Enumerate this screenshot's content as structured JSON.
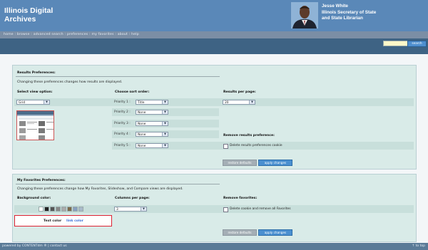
{
  "header": {
    "title_line1": "Illinois Digital",
    "title_line2": "Archives",
    "official_line1": "Jesse White",
    "official_line2": "Illinois Secretary of State",
    "official_line3": "and State Librarian",
    "bg_color": "#5a88b8"
  },
  "nav": {
    "items": [
      "home",
      "browse",
      "advanced search",
      "preferences",
      "my favorites",
      "about",
      "help"
    ],
    "separator": " : "
  },
  "search": {
    "placeholder": "",
    "button_label": "search"
  },
  "results_prefs": {
    "title": "Results Preferences:",
    "description": "Changing these preferences changes how results are displayed.",
    "view_label": "Select view option:",
    "view_value": "Grid",
    "sort_label": "Choose sort order:",
    "priorities": [
      {
        "label": "Priority 1 :",
        "value": "Title"
      },
      {
        "label": "Priority 2 :",
        "value": "None"
      },
      {
        "label": "Priority 3 :",
        "value": "None"
      },
      {
        "label": "Priority 4 :",
        "value": "None"
      },
      {
        "label": "Priority 5 :",
        "value": "None"
      }
    ],
    "per_page_label": "Results per page:",
    "per_page_value": "20",
    "remove_label": "Remove results preference:",
    "delete_cookie_label": "Delete results preferences cookie",
    "restore_button": "restore defaults",
    "apply_button": "apply changes"
  },
  "fav_prefs": {
    "title": "My Favorites Preferences:",
    "description": "Changing these preferences change how My Favorites, Slideshow, and Compare views are displayed.",
    "bg_color_label": "Background color:",
    "columns_label": "Columns per page:",
    "columns_value": "3",
    "remove_label": "Remove favorites:",
    "delete_label": "Delete cookie and remove all Favorites",
    "text_color_label": "Text color",
    "link_color_label": "link color",
    "swatches": [
      "#ffffff",
      "#222222",
      "#555555",
      "#888888",
      "#aaaaaa",
      "#7c6a4a",
      "#88a0c0",
      "#a8b8c8"
    ],
    "restore_button": "restore defaults",
    "apply_button": "apply changes"
  },
  "footer": {
    "left": "powered by CONTENTdm ® | contact us",
    "right": "↑ to top"
  }
}
